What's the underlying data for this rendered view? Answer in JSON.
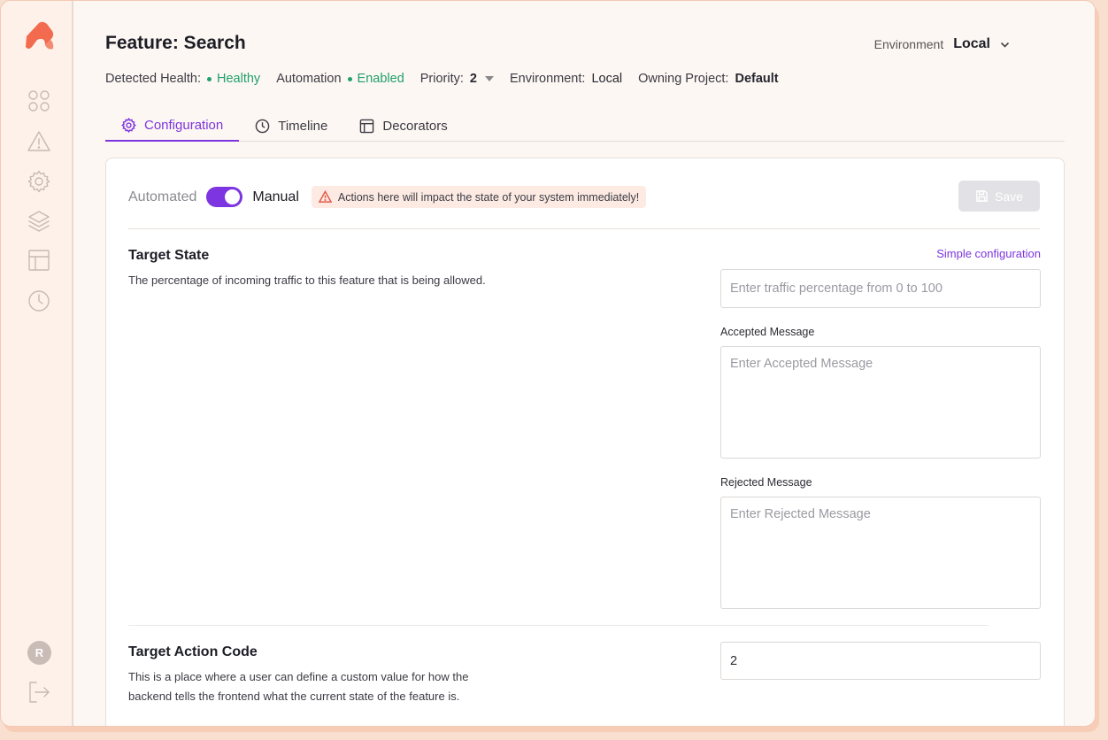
{
  "header": {
    "title": "Feature: Search",
    "environment_label": "Environment",
    "environment_value": "Local"
  },
  "meta": {
    "health_label": "Detected Health:",
    "health_value": "Healthy",
    "automation_label": "Automation",
    "automation_value": "Enabled",
    "priority_label": "Priority:",
    "priority_value": "2",
    "environment_label": "Environment:",
    "environment_value": "Local",
    "project_label": "Owning Project:",
    "project_value": "Default"
  },
  "tabs": [
    {
      "label": "Configuration",
      "icon": "gear-icon",
      "active": true
    },
    {
      "label": "Timeline",
      "icon": "clock-icon",
      "active": false
    },
    {
      "label": "Decorators",
      "icon": "layout-icon",
      "active": false
    }
  ],
  "mode": {
    "automated_label": "Automated",
    "manual_label": "Manual",
    "toggle_on": true,
    "warning": "Actions here will impact the state of your system immediately!"
  },
  "save_label": "Save",
  "target_state": {
    "title": "Target State",
    "description": "The percentage of incoming traffic to this feature that is being allowed.",
    "simple_link": "Simple configuration",
    "traffic_placeholder": "Enter traffic percentage from 0 to 100",
    "accepted_label": "Accepted Message",
    "accepted_placeholder": "Enter Accepted Message",
    "rejected_label": "Rejected Message",
    "rejected_placeholder": "Enter Rejected Message"
  },
  "target_action": {
    "title": "Target Action Code",
    "description": "This is a place where a user can define a custom value for how the backend tells the frontend what the current state of the feature is.",
    "value": "2"
  },
  "sidebar": {
    "avatar_initial": "R",
    "icons": [
      "grid-icon",
      "warning-icon",
      "gear-icon",
      "layers-icon",
      "layout-icon",
      "clock-icon",
      "logout-icon"
    ]
  },
  "colors": {
    "accent": "#7c35e0",
    "healthy": "#20a06b",
    "warning": "#e25c4b",
    "brand": "#f26b4f"
  }
}
